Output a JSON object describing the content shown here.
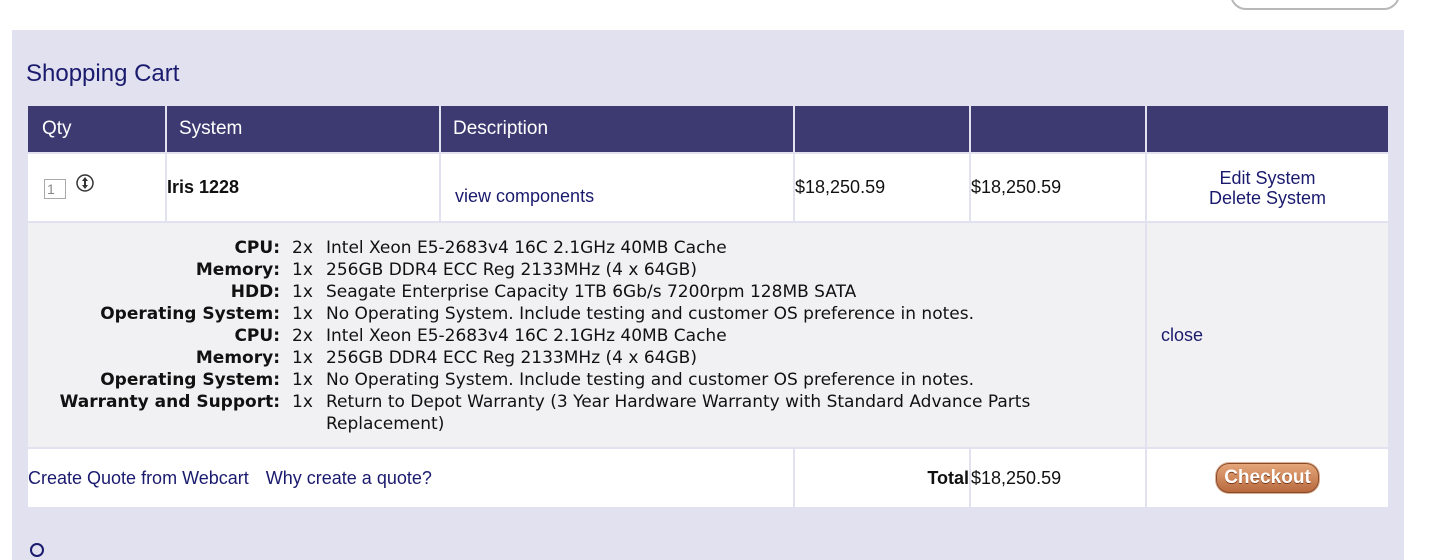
{
  "cart": {
    "title": "Shopping Cart",
    "columns": {
      "qty": "Qty",
      "system": "System",
      "description": "Description"
    },
    "item": {
      "qty": "1",
      "system": "Iris 1228",
      "view_components": "view components",
      "unit_price": "$18,250.59",
      "line_total": "$18,250.59",
      "edit": "Edit System",
      "delete": "Delete System"
    },
    "components": [
      {
        "label": "CPU:",
        "qty": "2x",
        "desc": "Intel Xeon E5-2683v4 16C 2.1GHz 40MB Cache"
      },
      {
        "label": "Memory:",
        "qty": "1x",
        "desc": "256GB DDR4 ECC Reg 2133MHz (4 x 64GB)"
      },
      {
        "label": "HDD:",
        "qty": "1x",
        "desc": "Seagate Enterprise Capacity 1TB 6Gb/s 7200rpm 128MB SATA"
      },
      {
        "label": "Operating System:",
        "qty": "1x",
        "desc": "No Operating System. Include testing and customer OS preference in notes."
      },
      {
        "label": "CPU:",
        "qty": "2x",
        "desc": "Intel Xeon E5-2683v4 16C 2.1GHz 40MB Cache"
      },
      {
        "label": "Memory:",
        "qty": "1x",
        "desc": "256GB DDR4 ECC Reg 2133MHz (4 x 64GB)"
      },
      {
        "label": "Operating System:",
        "qty": "1x",
        "desc": "No Operating System. Include testing and customer OS preference in notes."
      },
      {
        "label": "Warranty and Support:",
        "qty": "1x",
        "desc": "Return to Depot Warranty (3 Year Hardware Warranty with Standard Advance Parts Replacement)"
      }
    ],
    "close": "close",
    "footer": {
      "create_quote": "Create Quote from Webcart",
      "why_quote": "Why create a quote?",
      "total_label": "Total",
      "total_value": "$18,250.59",
      "checkout": "Checkout"
    }
  },
  "colors": {
    "panel_bg": "#e1e1ef",
    "header_bg": "#3d3a72",
    "link": "#1a1a6e",
    "checkout_orange": "#c97c4f"
  }
}
